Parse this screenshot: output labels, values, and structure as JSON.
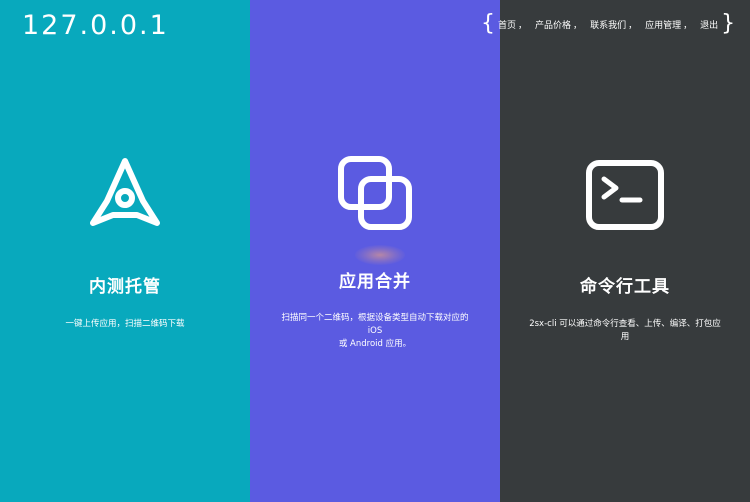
{
  "header": {
    "site_title": "127.0.0.1"
  },
  "nav": {
    "open_brace": "{",
    "close_brace": "}",
    "separator": "，",
    "items": [
      {
        "label": "首页"
      },
      {
        "label": "产品价格"
      },
      {
        "label": "联系我们"
      },
      {
        "label": "应用管理"
      },
      {
        "label": "退出"
      }
    ]
  },
  "features": [
    {
      "icon": "rocket-icon",
      "title": "内测托管",
      "desc_lines": [
        "一键上传应用，扫描二维码下载"
      ]
    },
    {
      "icon": "merge-squares-icon",
      "title": "应用合并",
      "desc_lines": [
        "扫描同一个二维码，根据设备类型自动下载对应的",
        "iOS",
        "或 Android 应用。"
      ]
    },
    {
      "icon": "terminal-icon",
      "title": "命令行工具",
      "desc_lines": [
        "2sx-cli 可以通过命令行查看、上传、编译、打包应",
        "用"
      ]
    }
  ],
  "colors": {
    "panel_1": "#08a9bd",
    "panel_2": "#5b5be1",
    "panel_3": "#373b3d",
    "text": "#ffffff"
  }
}
